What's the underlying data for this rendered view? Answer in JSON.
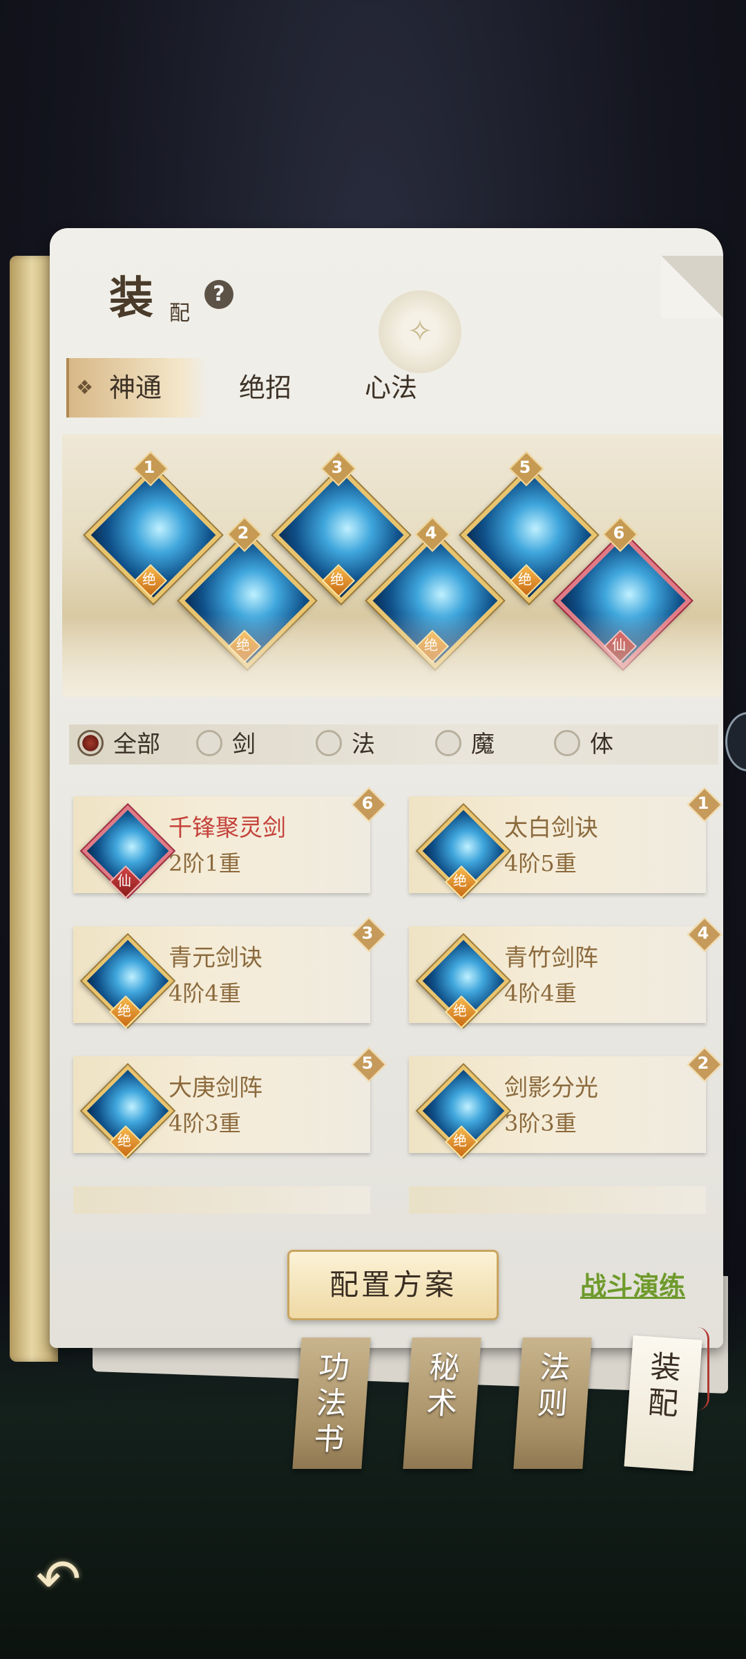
{
  "header": {
    "title_big": "装",
    "title_small": "配",
    "help_label": "?",
    "emblem_glyph": "✧"
  },
  "tabs": [
    {
      "label": "神通",
      "active": true
    },
    {
      "label": "绝招",
      "active": false
    },
    {
      "label": "心法",
      "active": false
    }
  ],
  "tab_marker": "❖",
  "slots": [
    {
      "number": "1",
      "grade": "绝"
    },
    {
      "number": "2",
      "grade": "绝"
    },
    {
      "number": "3",
      "grade": "绝"
    },
    {
      "number": "4",
      "grade": "绝"
    },
    {
      "number": "5",
      "grade": "绝"
    },
    {
      "number": "6",
      "grade": "仙"
    }
  ],
  "filters": [
    {
      "label": "全部",
      "selected": true
    },
    {
      "label": "剑",
      "selected": false
    },
    {
      "label": "法",
      "selected": false
    },
    {
      "label": "魔",
      "selected": false
    },
    {
      "label": "体",
      "selected": false
    }
  ],
  "skills": [
    {
      "name": "千锋聚灵剑",
      "level": "2阶1重",
      "slot": "6",
      "grade": "仙",
      "rare": true
    },
    {
      "name": "太白剑诀",
      "level": "4阶5重",
      "slot": "1",
      "grade": "绝",
      "rare": false
    },
    {
      "name": "青元剑诀",
      "level": "4阶4重",
      "slot": "3",
      "grade": "绝",
      "rare": false
    },
    {
      "name": "青竹剑阵",
      "level": "4阶4重",
      "slot": "4",
      "grade": "绝",
      "rare": false
    },
    {
      "name": "大庚剑阵",
      "level": "4阶3重",
      "slot": "5",
      "grade": "绝",
      "rare": false
    },
    {
      "name": "剑影分光",
      "level": "3阶3重",
      "slot": "2",
      "grade": "绝",
      "rare": false
    }
  ],
  "actions": {
    "plan": "配置方案",
    "battle": "战斗演练"
  },
  "book_tabs": [
    {
      "label": "功法书",
      "active": false
    },
    {
      "label": "秘术",
      "active": false
    },
    {
      "label": "法则",
      "active": false
    },
    {
      "label": "装配",
      "active": true
    }
  ],
  "back_glyph": "↶",
  "colors": {
    "accent_gold": "#c69a52",
    "rare_red": "#c4423a",
    "battle_green": "#6f9a2c"
  }
}
